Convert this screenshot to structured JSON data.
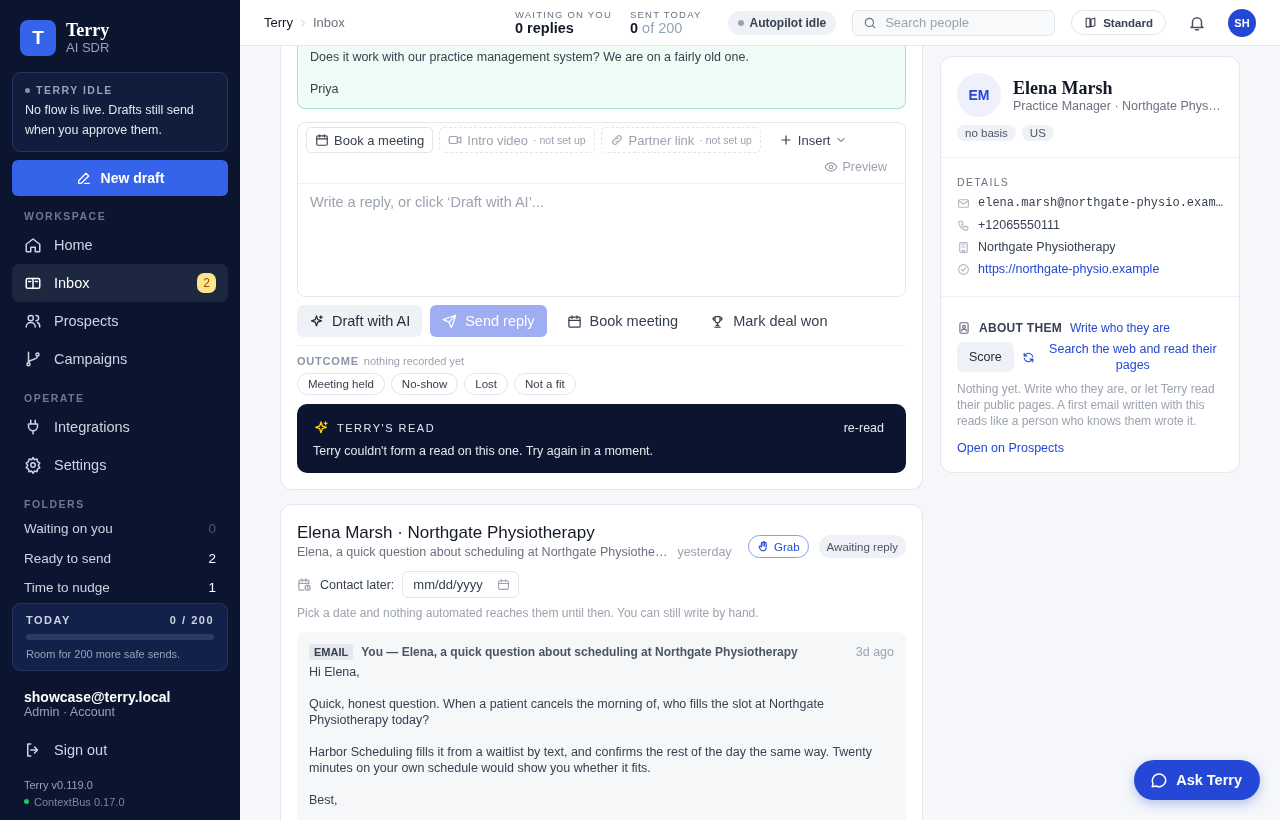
{
  "sidebar": {
    "brand": {
      "logo": "T",
      "name": "Terry",
      "tagline": "AI SDR"
    },
    "status": {
      "title": "TERRY IDLE",
      "text": "No flow is live. Drafts still send when you approve them."
    },
    "new_draft": "New draft",
    "sections": [
      {
        "label": "WORKSPACE",
        "items": [
          {
            "label": "Home",
            "selected": false
          },
          {
            "label": "Inbox",
            "selected": true,
            "badge": "2"
          },
          {
            "label": "Prospects",
            "selected": false
          },
          {
            "label": "Campaigns",
            "selected": false
          }
        ]
      },
      {
        "label": "OPERATE",
        "items": [
          {
            "label": "Integrations",
            "selected": false
          },
          {
            "label": "Settings",
            "selected": false
          }
        ]
      }
    ],
    "folders": {
      "label": "FOLDERS",
      "items": [
        {
          "label": "Waiting on you",
          "count": "0",
          "empty": true
        },
        {
          "label": "Ready to send",
          "count": "2",
          "empty": false
        },
        {
          "label": "Time to nudge",
          "count": "1",
          "empty": false
        }
      ]
    },
    "today": {
      "label": "TODAY",
      "count": "0 / 200",
      "level": 0,
      "note": "Room for 200 more safe sends."
    },
    "account": {
      "email": "showcase@terry.local",
      "role": "Admin · Account"
    },
    "sign_out": "Sign out",
    "version": "Terry v0.119.0",
    "service": {
      "label": "ContextBus 0.17.0",
      "online": true
    }
  },
  "topbar": {
    "breadcrumb": [
      "Terry",
      "Inbox"
    ],
    "stats": [
      {
        "label": "WAITING ON YOU",
        "value": "0 replies"
      },
      {
        "label": "SENT TODAY",
        "value": "**0** of 200"
      }
    ],
    "autopilot": "Autopilot idle",
    "search": {
      "placeholder": "Search people"
    },
    "mode": "Standard",
    "avatar": "SH"
  },
  "thread": {
    "message": [
      "Does it work with our practice management system? We are on a fairly old one.",
      "Priya"
    ],
    "composer": {
      "chips": [
        {
          "label": "Book a meeting",
          "disabled": false
        },
        {
          "label": "Intro video",
          "note": "· not set up",
          "disabled": true
        },
        {
          "label": "Partner link",
          "note": "· not set up",
          "disabled": true
        }
      ],
      "insert": "Insert",
      "preview": "Preview",
      "placeholder": "Write a reply, or click ‘Draft with AI’..."
    },
    "actions": [
      {
        "label": "Draft with AI",
        "kind": "soft",
        "disabled": false
      },
      {
        "label": "Send reply",
        "kind": "primary",
        "disabled": true
      },
      {
        "label": "Book meeting",
        "kind": "plain",
        "disabled": false
      },
      {
        "label": "Mark deal won",
        "kind": "plain",
        "disabled": false
      }
    ],
    "outcome": {
      "label": "OUTCOME",
      "note": "nothing recorded yet",
      "options": [
        {
          "label": "Meeting held",
          "selected": false
        },
        {
          "label": "No-show",
          "selected": false
        },
        {
          "label": "Lost",
          "selected": false
        },
        {
          "label": "Not a fit",
          "selected": false
        }
      ]
    },
    "read": {
      "title": "TERRY'S READ",
      "action": "re-read",
      "text": "Terry couldn't form a read on this one. Try again in a moment."
    }
  },
  "conversation": {
    "title": "Elena Marsh · Northgate Physiotherapy",
    "subject": "Elena, a quick question about scheduling at Northgate Physiothe…",
    "time": "yesterday",
    "grab": "Grab",
    "status": "Awaiting reply",
    "contact_later": {
      "label": "Contact later:",
      "placeholder": "mm/dd/yyyy"
    },
    "hint": "Pick a date and nothing automated reaches them until then. You can still write by hand.",
    "email": {
      "tag": "EMAIL",
      "subject": "You — Elena, a quick question about scheduling at Northgate Physiotherapy",
      "time": "3d ago",
      "paragraphs": [
        "Hi Elena,",
        "Quick, honest question. When a patient cancels the morning of, who fills the slot at Northgate Physiotherapy today?",
        "Harbor Scheduling fills it from a waitlist by text, and confirms the rest of the day the same way. Twenty minutes on your own schedule would show you whether it fits.",
        "Best,"
      ]
    }
  },
  "contact": {
    "initials": "EM",
    "name": "Elena Marsh",
    "role": "Practice Manager · Northgate Phys…",
    "tags": [
      "no basis",
      "US"
    ],
    "details_label": "DETAILS",
    "details": [
      {
        "kind": "email",
        "text": "elena.marsh@northgate-physio.exam…"
      },
      {
        "kind": "phone",
        "text": "+12065550111"
      },
      {
        "kind": "company",
        "text": "Northgate Physiotherapy"
      },
      {
        "kind": "website",
        "text": "https://northgate-physio.example"
      }
    ],
    "about": {
      "label": "ABOUT THEM",
      "write": "Write who they are",
      "score": "Score",
      "search": "Search the web and read their pages",
      "note": "Nothing yet. Write who they are, or let Terry read their public pages. A first email written with this reads like a person who knows them wrote it.",
      "open": "Open on Prospects"
    }
  },
  "assistant_button": "Ask Terry"
}
